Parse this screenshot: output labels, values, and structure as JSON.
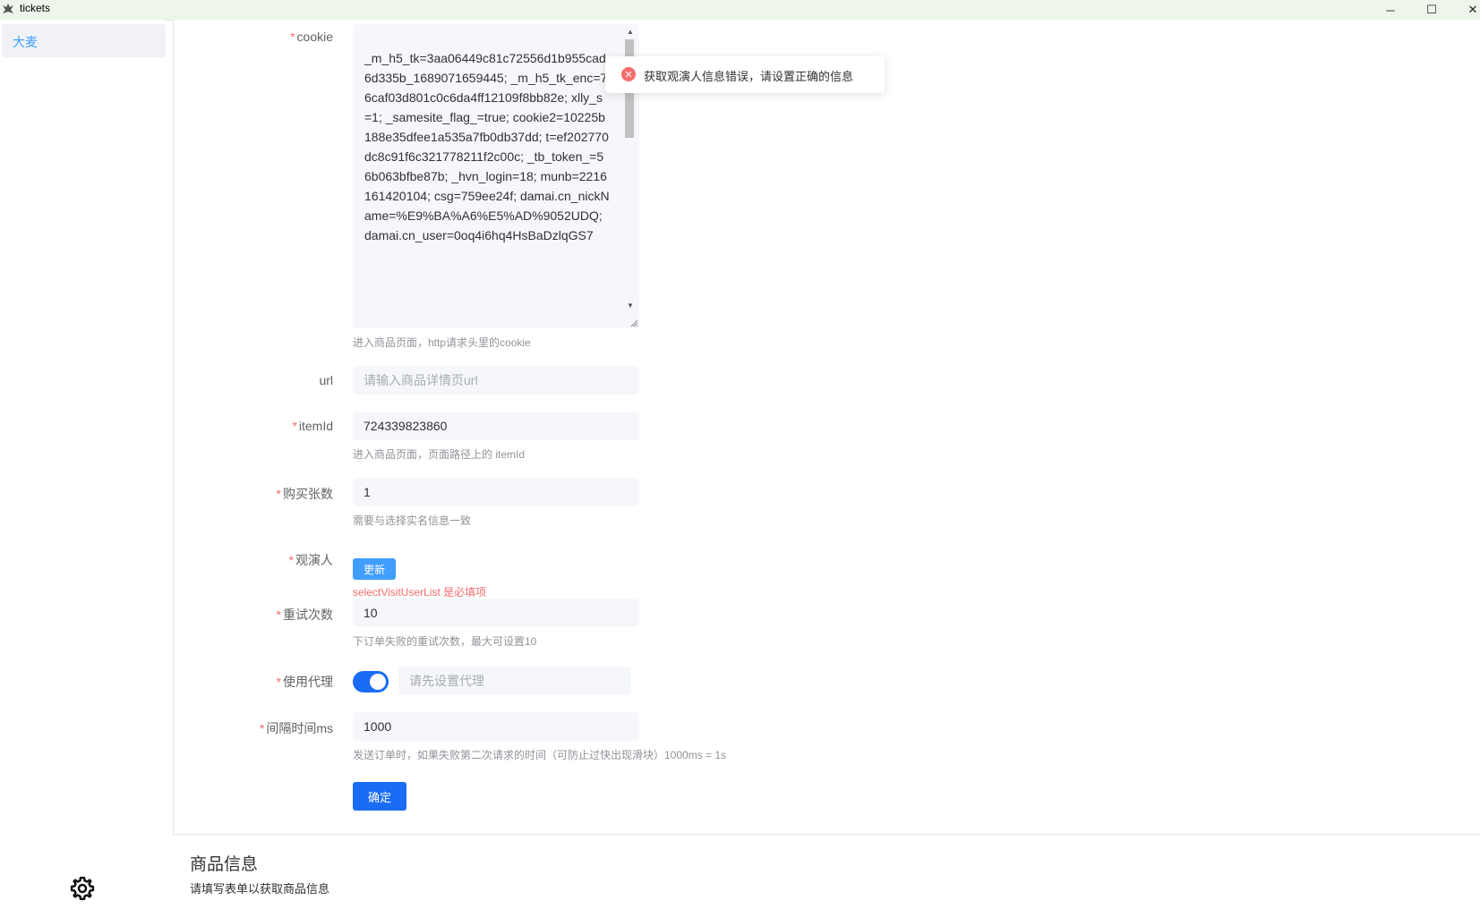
{
  "window": {
    "title": "tickets",
    "min_glyph": "─",
    "max_glyph": "☐",
    "close_glyph": "✕"
  },
  "sidebar": {
    "items": [
      {
        "label": "大麦"
      }
    ],
    "settings_icon": "gear-icon"
  },
  "form": {
    "required_mark": "*",
    "cookie": {
      "label": "cookie",
      "value": "_m_h5_tk=3aa06449c81c72556d1b955cad6d335b_1689071659445; _m_h5_tk_enc=76caf03d801c0c6da4ff12109f8bb82e; xlly_s=1; _samesite_flag_=true; cookie2=10225b188e35dfee1a535a7fb0db37dd; t=ef202770dc8c91f6c321778211f2c00c; _tb_token_=56b063bfbe87b; _hvn_login=18; munb=2216161420104; csg=759ee24f; damai.cn_nickName=%E9%BA%A6%E5%AD%9052UDQ; damai.cn_user=0oq4i6hq4HsBaDzlqGS7",
      "hint": "进入商品页面，http请求头里的cookie"
    },
    "url": {
      "label": "url",
      "placeholder": "请输入商品详情页url"
    },
    "itemId": {
      "label": "itemId",
      "value": "724339823860",
      "hint": "进入商品页面，页面路径上的 itemId"
    },
    "quantity": {
      "label": "购买张数",
      "value": "1",
      "hint": "需要与选择实名信息一致"
    },
    "viewer": {
      "label": "观演人",
      "update_button": "更新",
      "error": "selectVisitUserList 是必填项"
    },
    "retry": {
      "label": "重试次数",
      "value": "10",
      "hint": "下订单失败的重试次数，最大可设置10"
    },
    "proxy": {
      "label": "使用代理",
      "enabled": true,
      "placeholder": "请先设置代理"
    },
    "interval": {
      "label": "间隔时间ms",
      "value": "1000",
      "hint": "发送订单时，如果失败第二次请求的时间（可防止过快出现滑块）1000ms = 1s"
    },
    "submit_button": "确定"
  },
  "toast": {
    "type": "error",
    "icon": "✕",
    "message": "获取观演人信息错误，请设置正确的信息"
  },
  "product": {
    "title": "商品信息",
    "description": "请填写表单以获取商品信息"
  },
  "colors": {
    "accent": "#1a6cf5",
    "error": "#f56c6c",
    "sidebar_active_text": "#409eff"
  }
}
